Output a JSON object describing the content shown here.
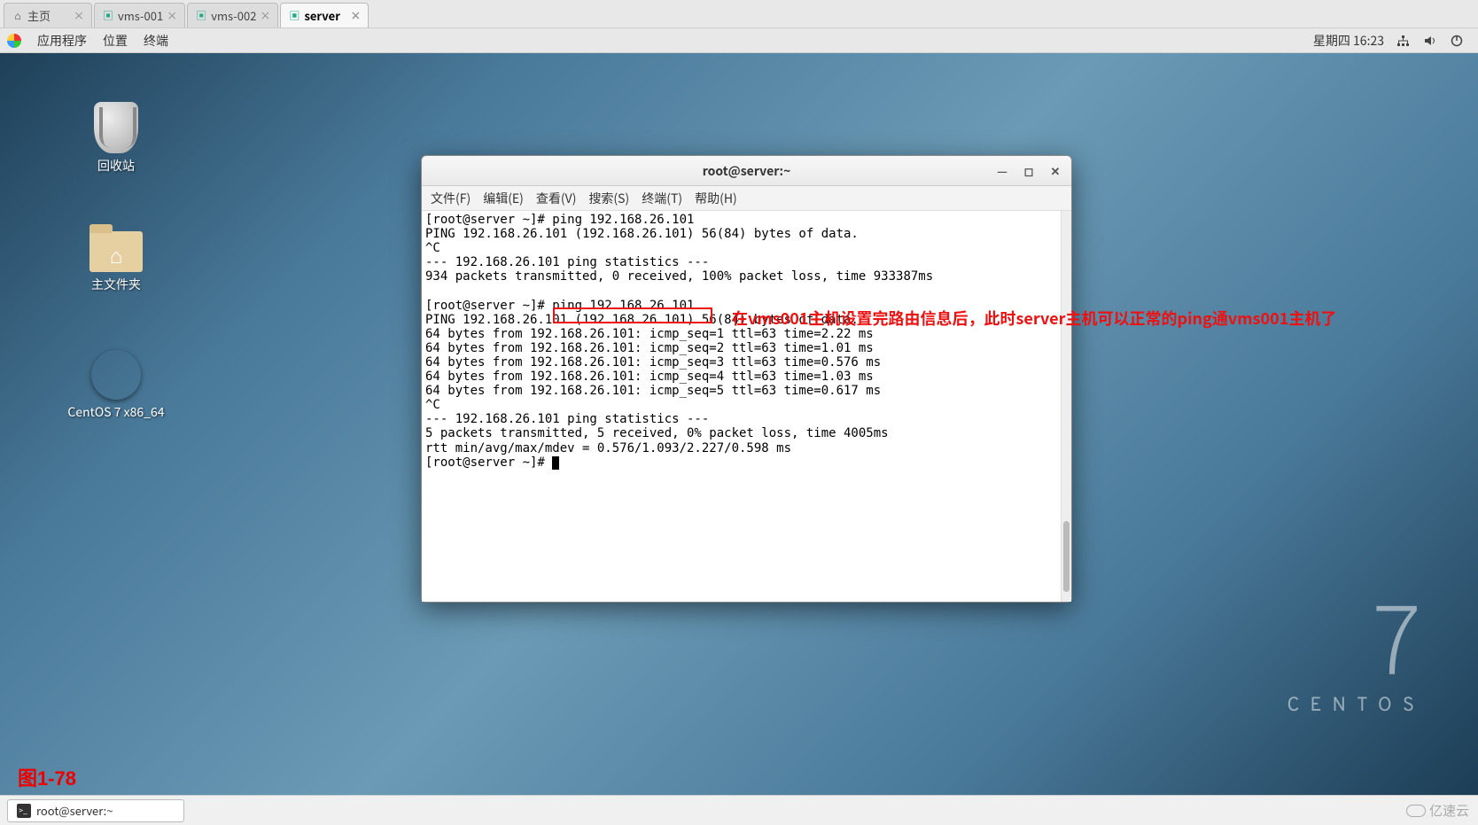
{
  "browserTabs": [
    {
      "label": "主页",
      "icon": "⌂",
      "active": false
    },
    {
      "label": "vms-001",
      "icon": "▣",
      "active": false
    },
    {
      "label": "vms-002",
      "icon": "▣",
      "active": false
    },
    {
      "label": "server",
      "icon": "▣",
      "active": true
    }
  ],
  "topBar": {
    "menus": [
      "应用程序",
      "位置",
      "终端"
    ],
    "dateTime": "星期四 16:23"
  },
  "desktopIcons": {
    "trash": "回收站",
    "home": "主文件夹",
    "disc": "CentOS 7 x86_64"
  },
  "centosWatermark": {
    "seven": "7",
    "name": "CENTOS"
  },
  "terminal": {
    "title": "root@server:~",
    "menus": [
      "文件(F)",
      "编辑(E)",
      "查看(V)",
      "搜索(S)",
      "终端(T)",
      "帮助(H)"
    ],
    "lines": [
      "[root@server ~]# ping 192.168.26.101",
      "PING 192.168.26.101 (192.168.26.101) 56(84) bytes of data.",
      "^C",
      "--- 192.168.26.101 ping statistics ---",
      "934 packets transmitted, 0 received, 100% packet loss, time 933387ms",
      "",
      "[root@server ~]# ping 192.168.26.101",
      "PING 192.168.26.101 (192.168.26.101) 56(84) bytes of data.",
      "64 bytes from 192.168.26.101: icmp_seq=1 ttl=63 time=2.22 ms",
      "64 bytes from 192.168.26.101: icmp_seq=2 ttl=63 time=1.01 ms",
      "64 bytes from 192.168.26.101: icmp_seq=3 ttl=63 time=0.576 ms",
      "64 bytes from 192.168.26.101: icmp_seq=4 ttl=63 time=1.03 ms",
      "64 bytes from 192.168.26.101: icmp_seq=5 ttl=63 time=0.617 ms",
      "^C",
      "--- 192.168.26.101 ping statistics ---",
      "5 packets transmitted, 5 received, 0% packet loss, time 4005ms",
      "rtt min/avg/max/mdev = 0.576/1.093/2.227/0.598 ms",
      "[root@server ~]# "
    ]
  },
  "annotation": "在vms001主机设置完路由信息后，此时server主机可以正常的ping通vms001主机了",
  "figureLabel": "图1-78",
  "taskbarItem": "root@server:~",
  "siteWatermark": "亿速云"
}
